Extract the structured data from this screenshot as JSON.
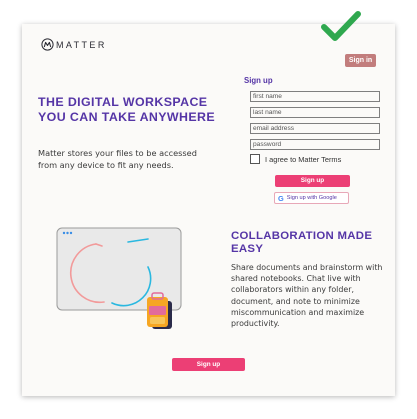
{
  "brand": {
    "name": "MATTER",
    "color": "#5535a6"
  },
  "header": {
    "signin_label": "Sign in"
  },
  "hero": {
    "title": "THE DIGITAL WORKSPACE YOU CAN TAKE ANYWHERE",
    "body": "Matter stores your files to be accessed from any device to fit any needs."
  },
  "signup_form": {
    "heading": "Sign up",
    "first_name_placeholder": "first name",
    "last_name_placeholder": "last name",
    "email_placeholder": "email address",
    "password_placeholder": "password",
    "terms_label": "I agree to Matter Terms",
    "terms_checked": false,
    "submit_label": "Sign up",
    "google_icon": "G",
    "google_label": "Sign up with Google"
  },
  "collab": {
    "title": "COLLABORATION MADE EASY",
    "body": "Share documents and brainstorm with shared notebooks. Chat live with collaborators within any folder, document, and note to minimize miscommunication and maximize productivity."
  },
  "footer": {
    "signup_label": "Sign up"
  },
  "colors": {
    "accent": "#5535a6",
    "primary_button": "#ec3f75",
    "signin_button": "#c27d7d",
    "check": "#2fa84f"
  }
}
